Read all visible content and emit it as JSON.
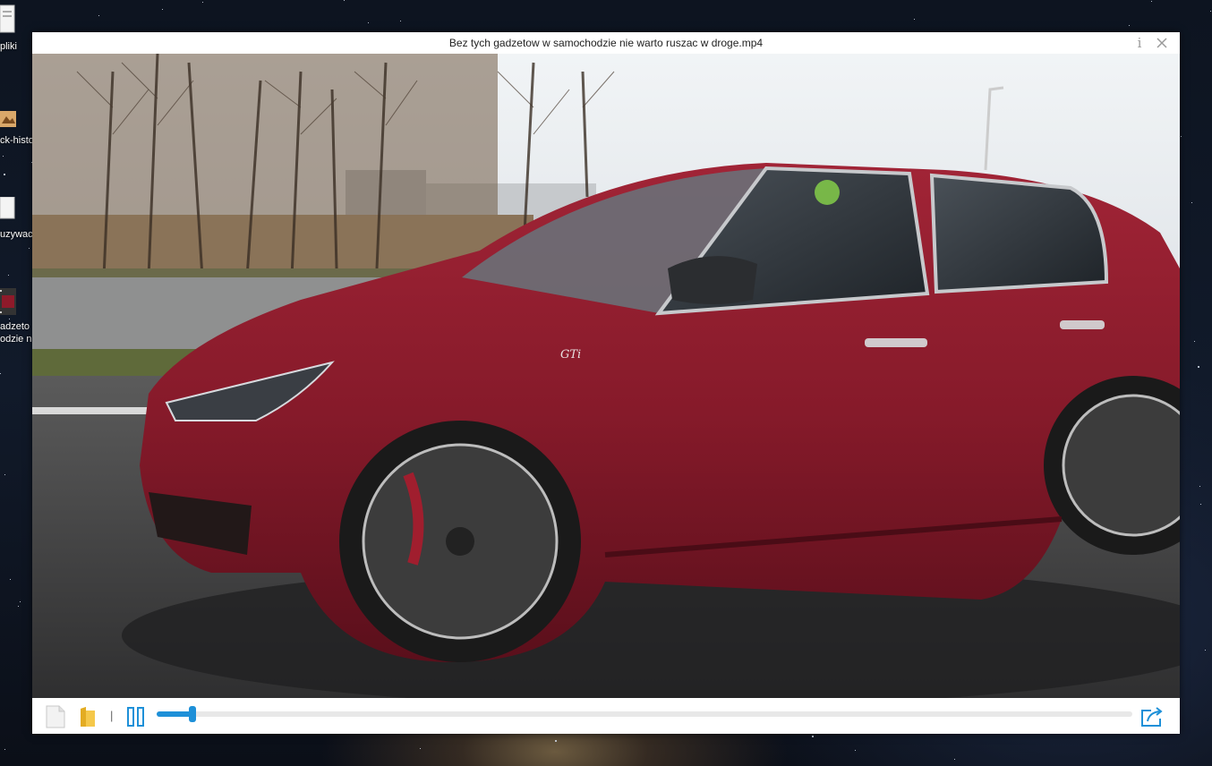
{
  "desktop": {
    "icons": [
      {
        "label": "pliki",
        "icon": "document-icon"
      },
      {
        "label": "ck-histo",
        "icon": "image-icon"
      },
      {
        "label": "uzywac",
        "icon": "document-icon"
      },
      {
        "label_line1": "adzeto",
        "label_line2": "odzie n",
        "icon": "video-thumbnail-icon"
      }
    ]
  },
  "player": {
    "title": "Bez tych gadzetow w samochodzie nie warto ruszac w droge.mp4",
    "info_icon": "info-icon",
    "close_icon": "close-icon",
    "controls": {
      "file_icon": "file-icon",
      "folder_icon": "folder-icon",
      "separator": "|",
      "pause_icon": "pause-icon",
      "share_icon": "share-icon",
      "progress": 0.037
    },
    "video": {
      "badge_text": "GTi"
    }
  },
  "colors": {
    "accent": "#1e90d8",
    "car_red": "#8e1a2a"
  }
}
